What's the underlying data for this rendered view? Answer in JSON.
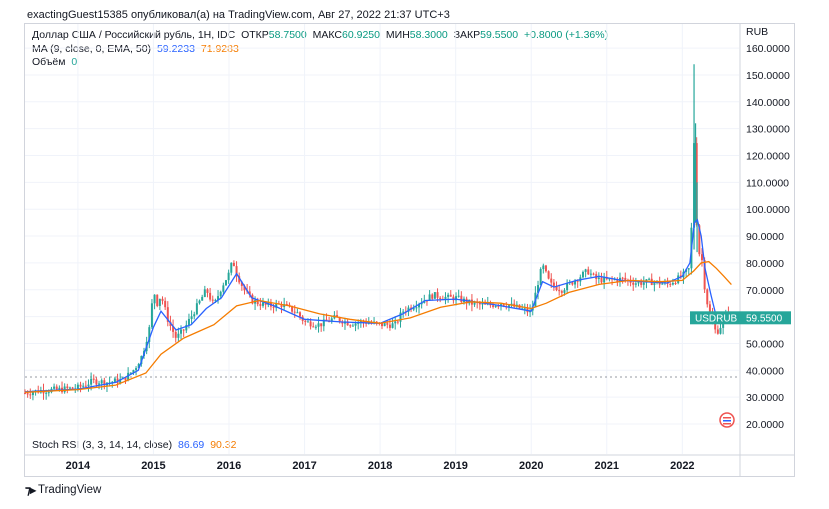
{
  "header": {
    "published_by": "exactingGuest15385 опубликовал(а) на TradingView.com, Авг 27, 2022 21:37 UTC+3"
  },
  "legend": {
    "symbol_line": "Доллар США / Российский рубль, 1H, IDC",
    "open_label": "ОТКР",
    "open_value": "58.7500",
    "high_label": "МАКС",
    "high_value": "60.9250",
    "low_label": "МИН",
    "low_value": "58.3000",
    "close_label": "ЗАКР",
    "close_value": "59.5500",
    "change": "+0.8000 (+1.36%)",
    "ma_label": "MA (9, close, 0, EMA, 50)",
    "ma_value_1": "59.2233",
    "ma_value_2": "71.9283",
    "volume_label": "Объём",
    "volume_value": "0",
    "stoch_label": "Stoch RSI (3, 3, 14, 14, close)",
    "stoch_k": "86.69",
    "stoch_d": "90.32"
  },
  "price_axis": {
    "currency": "RUB",
    "badge_symbol": "USDRUB",
    "badge_price": "59.5500"
  },
  "footer": {
    "brand": "TradingView"
  },
  "colors": {
    "up": "#26a69a",
    "down": "#ef5350",
    "ema9": "#2962ff",
    "ema50": "#f57c00",
    "badge": "#26a69a"
  },
  "chart_data": {
    "type": "line",
    "title": "Доллар США / Российский рубль, 1H, IDC",
    "ylabel": "RUB",
    "ylim": [
      20,
      160
    ],
    "yticks": [
      "20.0000",
      "30.0000",
      "40.0000",
      "50.0000",
      "60.0000",
      "70.0000",
      "80.0000",
      "90.0000",
      "100.0000",
      "110.0000",
      "120.0000",
      "130.0000",
      "140.0000",
      "150.0000",
      "160.0000"
    ],
    "xticks": [
      "2014",
      "2015",
      "2016",
      "2017",
      "2018",
      "2019",
      "2020",
      "2021",
      "2022"
    ],
    "xlim": [
      2013.3,
      2022.75
    ],
    "series": [
      {
        "name": "USDRUB",
        "x": [
          2013.3,
          2013.5,
          2013.75,
          2014.0,
          2014.2,
          2014.4,
          2014.6,
          2014.75,
          2014.85,
          2014.95,
          2015.0,
          2015.05,
          2015.1,
          2015.2,
          2015.3,
          2015.4,
          2015.5,
          2015.6,
          2015.7,
          2015.8,
          2015.9,
          2016.0,
          2016.05,
          2016.1,
          2016.2,
          2016.3,
          2016.5,
          2016.7,
          2016.9,
          2017.0,
          2017.2,
          2017.4,
          2017.6,
          2017.8,
          2018.0,
          2018.2,
          2018.3,
          2018.5,
          2018.7,
          2018.9,
          2019.0,
          2019.2,
          2019.4,
          2019.6,
          2019.8,
          2020.0,
          2020.1,
          2020.15,
          2020.25,
          2020.4,
          2020.6,
          2020.75,
          2020.85,
          2021.0,
          2021.2,
          2021.4,
          2021.6,
          2021.8,
          2022.0,
          2022.1,
          2022.13,
          2022.16,
          2022.19,
          2022.22,
          2022.26,
          2022.3,
          2022.35,
          2022.4,
          2022.45,
          2022.5,
          2022.55,
          2022.6,
          2022.65
        ],
        "values": [
          31.5,
          32.5,
          32.8,
          33.5,
          36.0,
          35.5,
          36.5,
          40.5,
          45.5,
          56.0,
          70.0,
          65.0,
          68.0,
          58.0,
          52.0,
          55.0,
          60.0,
          65.0,
          70.0,
          64.0,
          71.0,
          76.0,
          81.0,
          76.0,
          70.0,
          66.0,
          64.0,
          64.5,
          61.5,
          58.0,
          57.0,
          59.5,
          57.5,
          58.0,
          57.0,
          57.0,
          62.0,
          65.0,
          68.0,
          67.0,
          67.0,
          65.0,
          64.0,
          65.0,
          63.5,
          61.5,
          74.0,
          79.0,
          72.0,
          70.0,
          74.0,
          77.0,
          74.0,
          73.5,
          74.0,
          72.5,
          73.0,
          72.0,
          75.0,
          78.0,
          100.0,
          130.0,
          95.0,
          84.0,
          81.0,
          70.0,
          62.0,
          57.0,
          54.0,
          56.0,
          60.0,
          61.0,
          59.55
        ]
      },
      {
        "name": "EMA 9",
        "x": [
          2013.3,
          2014.0,
          2014.5,
          2014.8,
          2015.0,
          2015.1,
          2015.3,
          2015.5,
          2015.7,
          2015.9,
          2016.1,
          2016.3,
          2016.6,
          2017.0,
          2017.5,
          2018.0,
          2018.3,
          2018.6,
          2019.0,
          2019.5,
          2020.0,
          2020.15,
          2020.3,
          2020.6,
          2020.9,
          2021.2,
          2021.5,
          2021.8,
          2022.0,
          2022.1,
          2022.16,
          2022.2,
          2022.25,
          2022.3,
          2022.38,
          2022.45,
          2022.55,
          2022.65
        ],
        "values": [
          32.0,
          33.0,
          35.5,
          40.0,
          56.0,
          62.0,
          55.0,
          57.0,
          63.0,
          67.0,
          76.0,
          67.0,
          64.0,
          59.0,
          58.0,
          57.5,
          61.0,
          66.0,
          66.5,
          64.5,
          62.0,
          73.0,
          71.0,
          73.5,
          75.0,
          73.5,
          73.0,
          72.5,
          75.0,
          80.0,
          95.0,
          96.0,
          90.0,
          78.0,
          68.0,
          60.0,
          58.0,
          59.22
        ]
      },
      {
        "name": "EMA 50",
        "x": [
          2013.3,
          2014.0,
          2014.5,
          2014.9,
          2015.1,
          2015.4,
          2015.8,
          2016.1,
          2016.4,
          2016.8,
          2017.2,
          2017.6,
          2018.0,
          2018.4,
          2018.8,
          2019.2,
          2019.6,
          2020.0,
          2020.2,
          2020.5,
          2020.9,
          2021.3,
          2021.7,
          2022.0,
          2022.15,
          2022.25,
          2022.35,
          2022.45,
          2022.55,
          2022.65
        ],
        "values": [
          31.8,
          32.8,
          34.5,
          39.0,
          46.0,
          52.0,
          57.0,
          64.0,
          66.0,
          64.0,
          61.0,
          59.0,
          57.5,
          59.5,
          63.5,
          65.5,
          65.0,
          63.0,
          65.0,
          69.0,
          72.0,
          73.5,
          73.0,
          73.5,
          77.0,
          80.0,
          80.5,
          78.0,
          75.0,
          71.93
        ]
      }
    ],
    "reference_line": 37.5,
    "grid": true,
    "legend_position": "top-left"
  }
}
